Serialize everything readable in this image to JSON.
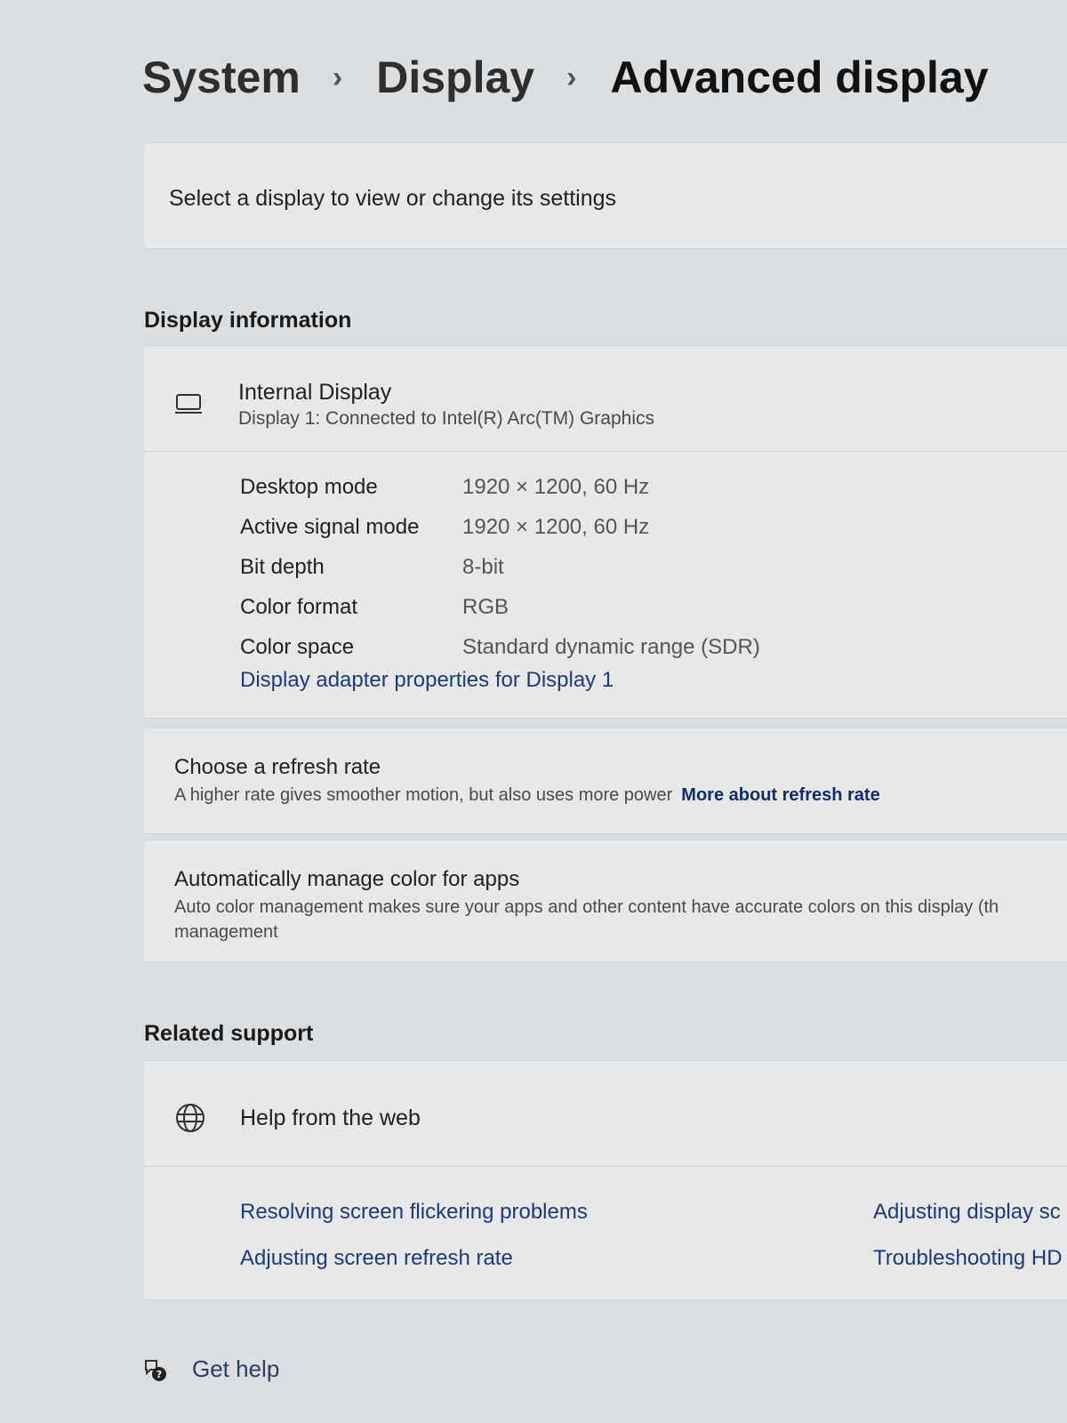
{
  "breadcrumb": {
    "items": [
      "System",
      "Display",
      "Advanced display"
    ],
    "separator": "›"
  },
  "select_display": {
    "label": "Select a display to view or change its settings"
  },
  "display_information": {
    "heading": "Display information",
    "icon": "laptop-icon",
    "title": "Internal Display",
    "subtitle": "Display 1: Connected to Intel(R) Arc(TM) Graphics",
    "properties": [
      {
        "name": "Desktop mode",
        "value": "1920 × 1200, 60 Hz"
      },
      {
        "name": "Active signal mode",
        "value": "1920 × 1200, 60 Hz"
      },
      {
        "name": "Bit depth",
        "value": "8-bit"
      },
      {
        "name": "Color format",
        "value": "RGB"
      },
      {
        "name": "Color space",
        "value": "Standard dynamic range (SDR)"
      }
    ],
    "adapter_link": "Display adapter properties for Display 1"
  },
  "refresh_rate": {
    "title": "Choose a refresh rate",
    "description": "A higher rate gives smoother motion, but also uses more power",
    "more_link": "More about refresh rate"
  },
  "color_management": {
    "title": "Automatically manage color for apps",
    "description_line1": "Auto color management makes sure your apps and other content have accurate colors on this display (th",
    "description_line2": "management"
  },
  "related_support": {
    "heading": "Related support",
    "help_title": "Help from the web",
    "help_icon": "globe-icon",
    "links_left": [
      "Resolving screen flickering problems",
      "Adjusting screen refresh rate"
    ],
    "links_right": [
      "Adjusting display sc",
      "Troubleshooting HD"
    ]
  },
  "get_help": {
    "label": "Get help",
    "icon": "help-icon"
  },
  "colors": {
    "background": "#dcdfe1",
    "card": "#e6e8ea",
    "link": "#1d3a7a",
    "link_bold": "#0f2f6b"
  }
}
